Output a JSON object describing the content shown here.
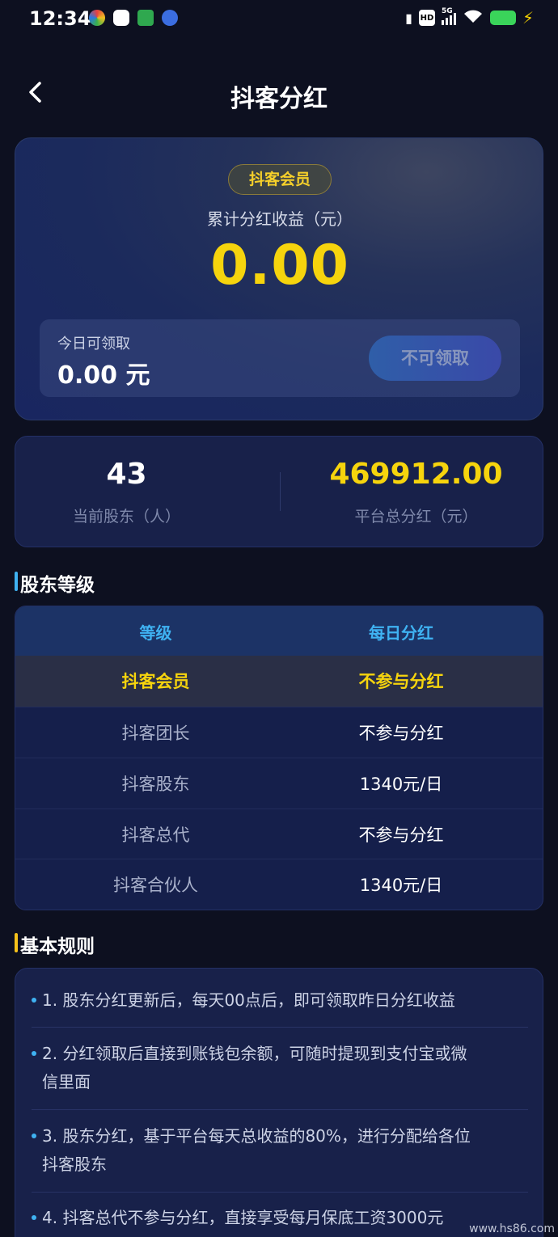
{
  "status_bar": {
    "time": "12:34",
    "network": "5G",
    "hd": "HD",
    "battery_color": "#3ad45a"
  },
  "header": {
    "title": "抖客分红",
    "back_icon": "chevron-left-icon"
  },
  "hero": {
    "badge": "抖客会员",
    "cumulative_label": "累计分红收益（元）",
    "cumulative_value": "0.00",
    "today_label": "今日可领取",
    "today_value": "0.00 元",
    "claim_button": "不可领取"
  },
  "stats": {
    "shareholders_value": "43",
    "shareholders_label": "当前股东（人）",
    "total_dividend_value": "469912.00",
    "total_dividend_label": "平台总分红（元）"
  },
  "levels": {
    "section_title": "股东等级",
    "accent": "#3fb2f2",
    "headers": [
      "等级",
      "每日分红"
    ],
    "rows": [
      {
        "level": "抖客会员",
        "daily": "不参与分红"
      },
      {
        "level": "抖客团长",
        "daily": "不参与分红"
      },
      {
        "level": "抖客股东",
        "daily": "1340元/日"
      },
      {
        "level": "抖客总代",
        "daily": "不参与分红"
      },
      {
        "level": "抖客合伙人",
        "daily": "1340元/日"
      }
    ]
  },
  "rules": {
    "section_title": "基本规则",
    "accent": "#f6c21a",
    "items": [
      {
        "line1": "1. 股东分红更新后，每天00点后，即可领取昨日分红收益",
        "line2": ""
      },
      {
        "line1": "2. 分红领取后直接到账钱包余额，可随时提现到支付宝或微",
        "line2": "信里面"
      },
      {
        "line1": "3. 股东分红，基于平台每天总收益的80%，进行分配给各位",
        "line2": "抖客股东"
      },
      {
        "line1": "4. 抖客总代不参与分红，直接享受每月保底工资3000元",
        "line2": ""
      }
    ]
  },
  "watermark": "www.hs86.com"
}
